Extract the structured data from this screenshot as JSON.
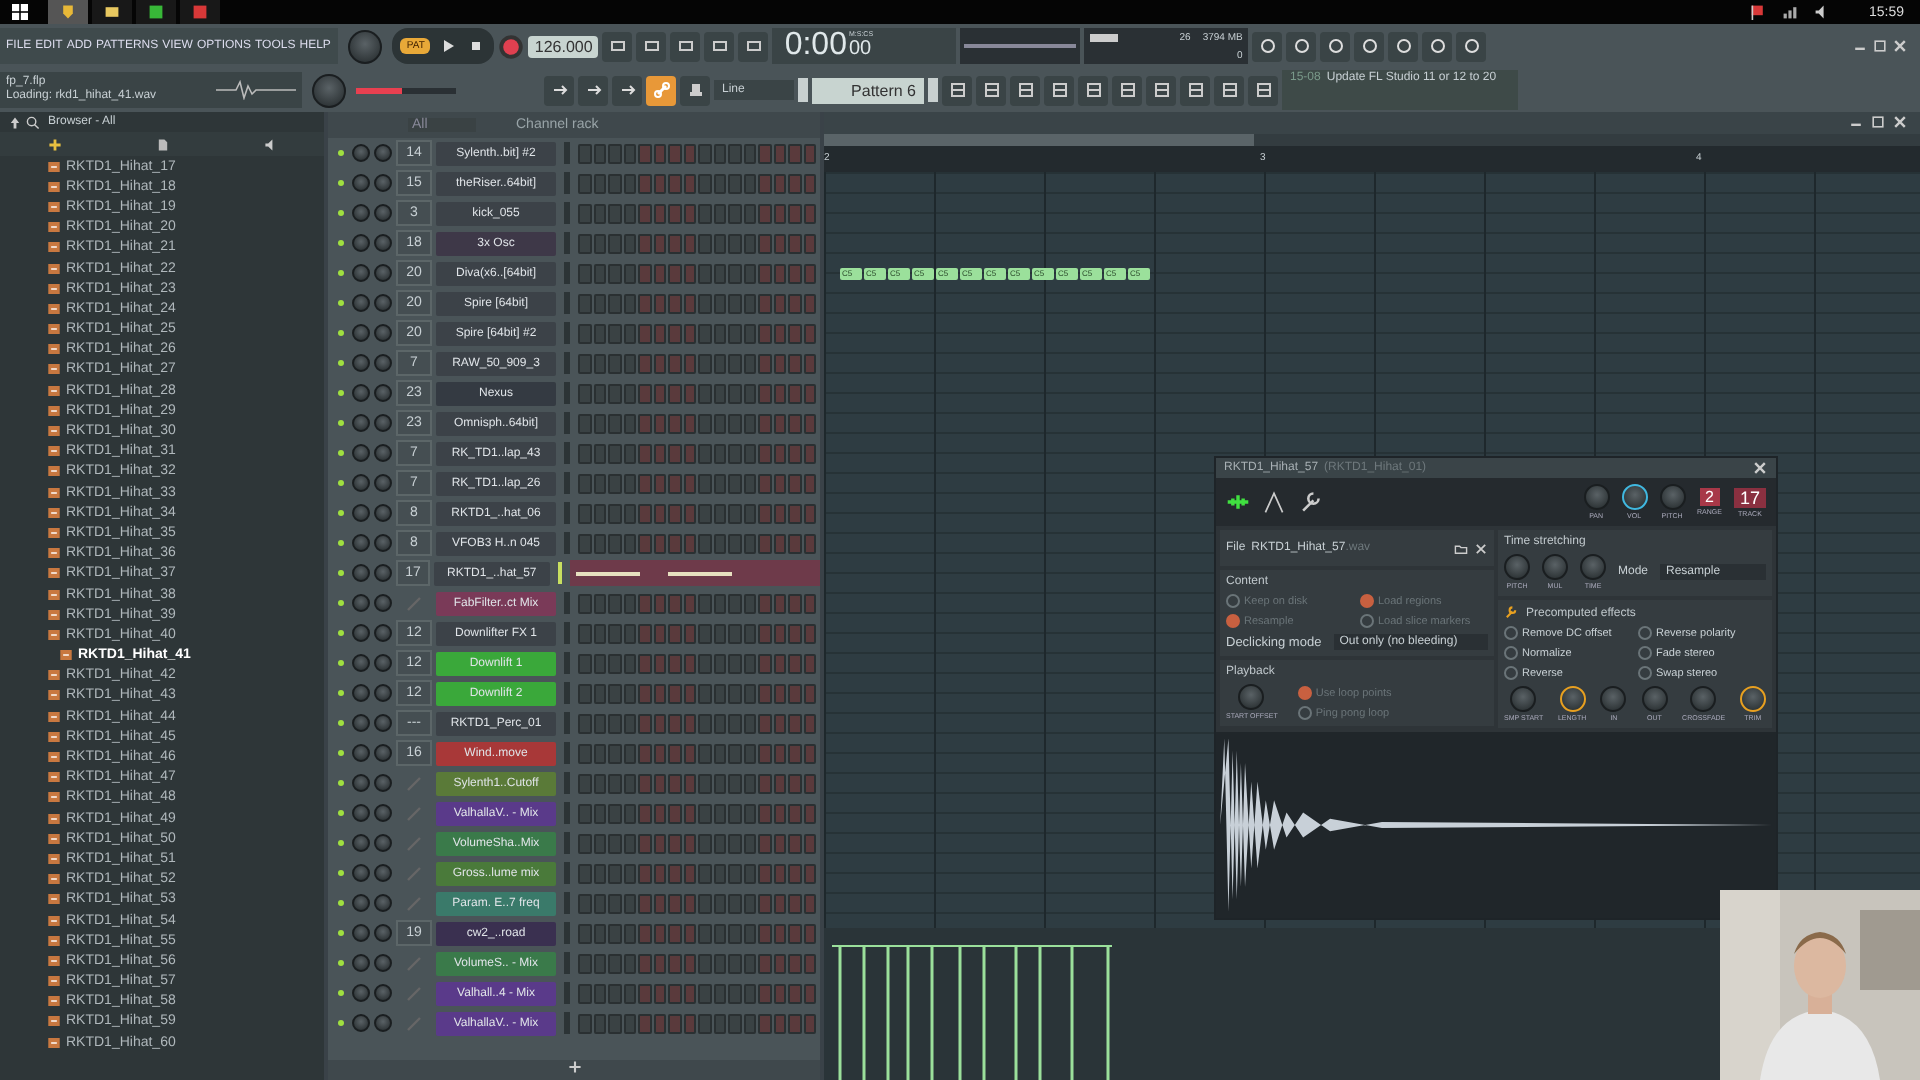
{
  "taskbar": {
    "clock": "15:59"
  },
  "menu": [
    "FILE",
    "EDIT",
    "ADD",
    "PATTERNS",
    "VIEW",
    "OPTIONS",
    "TOOLS",
    "HELP"
  ],
  "project": {
    "file": "fp_7.flp",
    "status": "Loading: rkd1_hihat_41.wav"
  },
  "transport": {
    "mode": "PAT",
    "tempo": "126.000",
    "time": "0:00",
    "time_cs": "00",
    "time_unit": "M:S:CS"
  },
  "monitor": {
    "cpu": "26",
    "memory": "3794 MB",
    "polyphony": "0"
  },
  "master_pitch": {
    "level": 0.45
  },
  "link_active": true,
  "snap": "Line",
  "pattern": "Pattern 6",
  "hint": {
    "time": "15-08",
    "text": "Update FL Studio 11 or 12 to 20"
  },
  "browser": {
    "title": "Browser - All",
    "items": [
      {
        "name": "RKTD1_Hihat_17",
        "dragging": false
      },
      {
        "name": "RKTD1_Hihat_18",
        "dragging": false
      },
      {
        "name": "RKTD1_Hihat_19",
        "dragging": false
      },
      {
        "name": "RKTD1_Hihat_20",
        "dragging": false
      },
      {
        "name": "RKTD1_Hihat_21",
        "dragging": false
      },
      {
        "name": "RKTD1_Hihat_22",
        "dragging": false
      },
      {
        "name": "RKTD1_Hihat_23",
        "dragging": false
      },
      {
        "name": "RKTD1_Hihat_24",
        "dragging": false
      },
      {
        "name": "RKTD1_Hihat_25",
        "dragging": false
      },
      {
        "name": "RKTD1_Hihat_26",
        "dragging": false
      },
      {
        "name": "RKTD1_Hihat_27",
        "dragging": false
      },
      {
        "name": "RKTD1_Hihat_28",
        "dragging": false
      },
      {
        "name": "RKTD1_Hihat_29",
        "dragging": false
      },
      {
        "name": "RKTD1_Hihat_30",
        "dragging": false
      },
      {
        "name": "RKTD1_Hihat_31",
        "dragging": false
      },
      {
        "name": "RKTD1_Hihat_32",
        "dragging": false
      },
      {
        "name": "RKTD1_Hihat_33",
        "dragging": false
      },
      {
        "name": "RKTD1_Hihat_34",
        "dragging": false
      },
      {
        "name": "RKTD1_Hihat_35",
        "dragging": false
      },
      {
        "name": "RKTD1_Hihat_36",
        "dragging": false
      },
      {
        "name": "RKTD1_Hihat_37",
        "dragging": false
      },
      {
        "name": "RKTD1_Hihat_38",
        "dragging": false
      },
      {
        "name": "RKTD1_Hihat_39",
        "dragging": false
      },
      {
        "name": "RKTD1_Hihat_40",
        "dragging": false
      },
      {
        "name": "RKTD1_Hihat_41",
        "dragging": true
      },
      {
        "name": "RKTD1_Hihat_42",
        "dragging": false
      },
      {
        "name": "RKTD1_Hihat_43",
        "dragging": false
      },
      {
        "name": "RKTD1_Hihat_44",
        "dragging": false
      },
      {
        "name": "RKTD1_Hihat_45",
        "dragging": false
      },
      {
        "name": "RKTD1_Hihat_46",
        "dragging": false
      },
      {
        "name": "RKTD1_Hihat_47",
        "dragging": false
      },
      {
        "name": "RKTD1_Hihat_48",
        "dragging": false
      },
      {
        "name": "RKTD1_Hihat_49",
        "dragging": false
      },
      {
        "name": "RKTD1_Hihat_50",
        "dragging": false
      },
      {
        "name": "RKTD1_Hihat_51",
        "dragging": false
      },
      {
        "name": "RKTD1_Hihat_52",
        "dragging": false
      },
      {
        "name": "RKTD1_Hihat_53",
        "dragging": false
      },
      {
        "name": "RKTD1_Hihat_54",
        "dragging": false
      },
      {
        "name": "RKTD1_Hihat_55",
        "dragging": false
      },
      {
        "name": "RKTD1_Hihat_56",
        "dragging": false
      },
      {
        "name": "RKTD1_Hihat_57",
        "dragging": false
      },
      {
        "name": "RKTD1_Hihat_58",
        "dragging": false
      },
      {
        "name": "RKTD1_Hihat_59",
        "dragging": false
      },
      {
        "name": "RKTD1_Hihat_60",
        "dragging": false
      }
    ]
  },
  "channel_rack": {
    "filter": "All",
    "title": "Channel rack",
    "channels": [
      {
        "track": "14",
        "name": "Sylenth..bit] #2",
        "color": "#3c4248",
        "selected": false
      },
      {
        "track": "15",
        "name": "theRiser..64bit]",
        "color": "#3c4248",
        "selected": false
      },
      {
        "track": "3",
        "name": "kick_055",
        "color": "#3c4248",
        "selected": false
      },
      {
        "track": "18",
        "name": "3x Osc",
        "color": "#3e3848",
        "selected": false
      },
      {
        "track": "20",
        "name": "Diva(x6..[64bit]",
        "color": "#3c4248",
        "selected": false
      },
      {
        "track": "20",
        "name": "Spire [64bit]",
        "color": "#3c4248",
        "selected": false
      },
      {
        "track": "20",
        "name": "Spire [64bit] #2",
        "color": "#3c4248",
        "selected": false
      },
      {
        "track": "7",
        "name": "RAW_50_909_3",
        "color": "#3c4248",
        "selected": false
      },
      {
        "track": "23",
        "name": "Nexus",
        "color": "#343a42",
        "selected": false
      },
      {
        "track": "23",
        "name": "Omnisph..64bit]",
        "color": "#3c4248",
        "selected": false
      },
      {
        "track": "7",
        "name": "RK_TD1..lap_43",
        "color": "#3c4248",
        "selected": false
      },
      {
        "track": "7",
        "name": "RK_TD1..lap_26",
        "color": "#3c4248",
        "selected": false
      },
      {
        "track": "8",
        "name": "RKTD1_..hat_06",
        "color": "#3c4248",
        "selected": false
      },
      {
        "track": "8",
        "name": "VFOB3 H..n 045",
        "color": "#3c4248",
        "selected": false
      },
      {
        "track": "17",
        "name": "RKTD1_..hat_57",
        "color": "#3c4248",
        "selected": true
      },
      {
        "name": "FabFilter..ct Mix",
        "color": "#7a3a58",
        "selected": false
      },
      {
        "track": "12",
        "name": "Downlifter FX 1",
        "color": "#3c4248",
        "selected": false
      },
      {
        "track": "12",
        "name": "Downlift 1",
        "color": "#3aa83a",
        "selected": false
      },
      {
        "track": "12",
        "name": "Downlift 2",
        "color": "#3aa83a",
        "selected": false
      },
      {
        "track": "---",
        "name": "RKTD1_Perc_01",
        "color": "#3c4248",
        "selected": false
      },
      {
        "track": "16",
        "name": "Wind..move",
        "color": "#a83838",
        "selected": false
      },
      {
        "name": "Sylenth1..Cutoff",
        "color": "#5a7a38",
        "selected": false
      },
      {
        "name": "ValhallaV.. - Mix",
        "color": "#5a3a8a",
        "selected": false
      },
      {
        "name": "VolumeSha..Mix",
        "color": "#3a7a4a",
        "selected": false
      },
      {
        "name": "Gross..lume mix",
        "color": "#4a7a3a",
        "selected": false
      },
      {
        "name": "Param. E..7 freq",
        "color": "#3a7a6a",
        "selected": false
      },
      {
        "track": "19",
        "name": "cw2_..road",
        "color": "#3a3050",
        "selected": false
      },
      {
        "name": "VolumeS.. - Mix",
        "color": "#3a7a4a",
        "selected": false
      },
      {
        "name": "Valhall..4 - Mix",
        "color": "#5a3a8a",
        "selected": false
      },
      {
        "name": "ValhallaV.. - Mix",
        "color": "#5a3a8a",
        "selected": false
      }
    ]
  },
  "piano_roll": {
    "bars": [
      "2",
      "3",
      "4"
    ],
    "notes": [
      "C5",
      "C5",
      "C5",
      "C5",
      "C5",
      "C5",
      "C5",
      "C5",
      "C5",
      "C5",
      "C5",
      "C5",
      "C5"
    ]
  },
  "sampler": {
    "title": "RKTD1_Hihat_57",
    "subtitle": "(RKTD1_Hihat_01)",
    "knobs": [
      {
        "label": "PAN",
        "active": false
      },
      {
        "label": "VOL",
        "active": true
      },
      {
        "label": "PITCH",
        "active": false
      }
    ],
    "range": {
      "value": "2",
      "label": "RANGE"
    },
    "track": {
      "value": "17",
      "label": "TRACK"
    },
    "file": {
      "label": "File",
      "name": "RKTD1_Hihat_57",
      "ext": ".wav"
    },
    "content": {
      "title": "Content",
      "options": [
        {
          "label": "Keep on disk",
          "checked": false
        },
        {
          "label": "Load regions",
          "checked": true
        },
        {
          "label": "Resample",
          "checked": true
        },
        {
          "label": "Load slice markers",
          "checked": false
        }
      ]
    },
    "declicking": {
      "label": "Declicking mode",
      "value": "Out only (no bleeding)"
    },
    "playback": {
      "title": "Playback",
      "knob": "START OFFSET",
      "options": [
        {
          "label": "Use loop points",
          "checked": true
        },
        {
          "label": "Ping pong loop",
          "checked": false
        }
      ]
    },
    "time_stretching": {
      "title": "Time stretching",
      "knobs": [
        "PITCH",
        "MUL",
        "TIME"
      ],
      "mode_label": "Mode",
      "mode": "Resample"
    },
    "effects": {
      "title": "Precomputed effects",
      "options": [
        {
          "label": "Remove DC offset",
          "checked": false
        },
        {
          "label": "Reverse polarity",
          "checked": false
        },
        {
          "label": "Normalize",
          "checked": false
        },
        {
          "label": "Fade stereo",
          "checked": false
        },
        {
          "label": "Reverse",
          "checked": false
        },
        {
          "label": "Swap stereo",
          "checked": false
        }
      ],
      "knobs": [
        {
          "label": "SMP START",
          "active": false
        },
        {
          "label": "LENGTH",
          "active": true
        },
        {
          "label": "IN",
          "active": false
        },
        {
          "label": "OUT",
          "active": false
        },
        {
          "label": "CROSSFADE",
          "active": false
        },
        {
          "label": "TRIM",
          "active": true
        }
      ]
    }
  }
}
